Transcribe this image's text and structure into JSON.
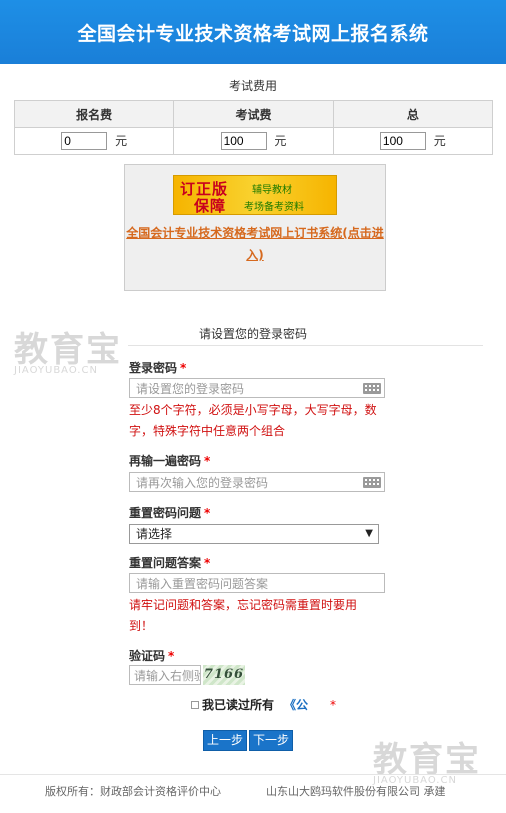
{
  "header": {
    "title": "全国会计专业技术资格考试网上报名系统"
  },
  "fees": {
    "title": "考试费用",
    "columns": [
      "报名费",
      "考试费",
      "总"
    ],
    "values": [
      "0",
      "100",
      "100"
    ],
    "unit": "元"
  },
  "ad": {
    "banner_big1": "订正版",
    "banner_big2": "保障",
    "banner_small1": "辅导教材",
    "banner_small2": "考场备考资料",
    "link": "全国会计专业技术资格考试网上订书系统(点击进入)"
  },
  "watermark": {
    "cn": "教育宝",
    "en": "JIAOYUBAO.CN"
  },
  "password_section": {
    "title": "请设置您的登录密码",
    "login_pwd_label": "登录密码",
    "login_pwd_placeholder": "请设置您的登录密码",
    "login_pwd_hint": "至少8个字符，必须是小写字母，大写字母，数字，特殊字符中任意两个组合",
    "confirm_label": "再输一遍密码",
    "confirm_placeholder": "请再次输入您的登录密码",
    "question_label": "重置密码问题",
    "question_selected": "请选择",
    "answer_label": "重置问题答案",
    "answer_placeholder": "请输入重置密码问题答案",
    "answer_hint": "请牢记问题和答案，忘记密码需重置时要用到！",
    "captcha_label": "验证码",
    "captcha_placeholder": "请输入右侧验证码",
    "captcha_text": "7166",
    "required_mark": "*"
  },
  "agree": {
    "text": "我已读过所有",
    "doc": "《公"
  },
  "buttons": {
    "prev": "上一步",
    "next": "下一步"
  },
  "footer": {
    "copyright": "版权所有：财政部会计资格评价中心",
    "tech": "山东山大鸥玛软件股份有限公司 承建"
  },
  "colors": {
    "header_blue": "#1a7fd8",
    "error_red": "#d01010",
    "button_blue": "#1a74c9",
    "link_orange": "#d6691e"
  }
}
